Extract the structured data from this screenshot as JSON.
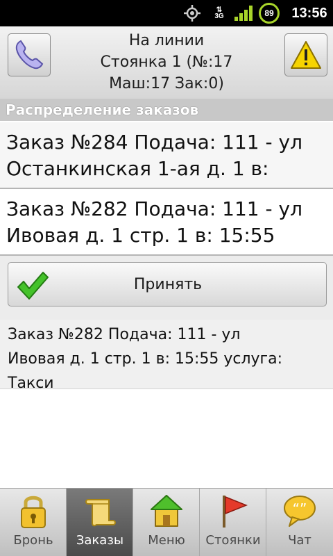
{
  "status_bar": {
    "battery_percent": "89",
    "network": "3G",
    "time": "13:56"
  },
  "header": {
    "line1": "На линии",
    "line2": "Стоянка 1 (№:17",
    "line3": "Маш:17 Зак:0)",
    "left_icon": "phone-icon",
    "right_icon": "warning-icon"
  },
  "section_title": "Распределение заказов",
  "orders": [
    {
      "line1": "Заказ №284 Подача: 111 -  ул",
      "line2": "Останкинская 1-ая д. 1 в:"
    },
    {
      "line1": "Заказ №282 Подача: 111 -  ул",
      "line2": "Ивовая д. 1 стр. 1 в: 15:55"
    }
  ],
  "accept_button": {
    "label": "Принять",
    "icon": "check-icon"
  },
  "details": "Заказ №282 Подача: 111 -  ул\nИвовая д. 1 стр. 1 в: 15:55 услуга:\nТакси",
  "bottom_nav": {
    "active": "Заказы",
    "items": [
      {
        "label": "Бронь",
        "icon": "lock-icon"
      },
      {
        "label": "Заказы",
        "icon": "scroll-icon"
      },
      {
        "label": "Меню",
        "icon": "home-icon"
      },
      {
        "label": "Стоянки",
        "icon": "flag-icon"
      },
      {
        "label": "Чат",
        "icon": "chat-bubble-icon"
      }
    ]
  },
  "colors": {
    "accent_check": "#33b51e",
    "warning_yellow": "#f6d400",
    "active_tab_bg": "#5a5a5a"
  }
}
